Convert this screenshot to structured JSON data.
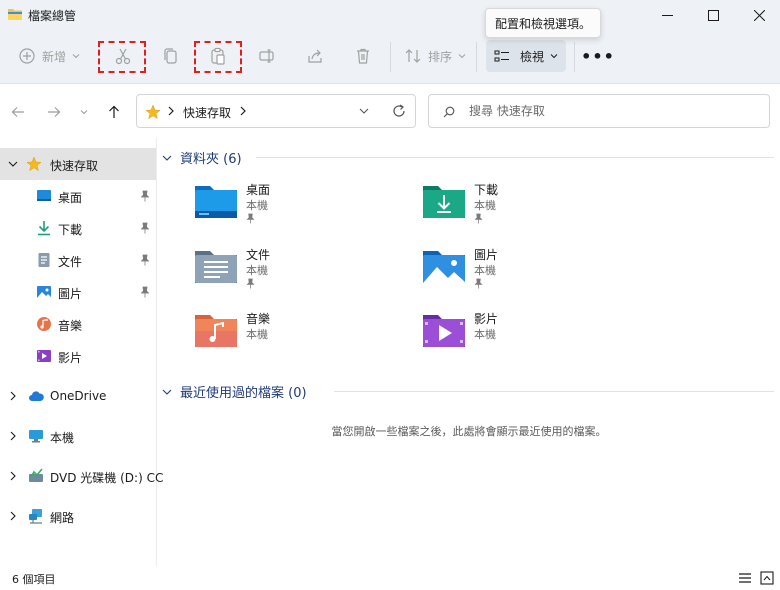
{
  "window": {
    "title": "檔案總管",
    "title_icon": "folder-icon",
    "minimize_icon": "minimize-icon",
    "maximize_icon": "maximize-icon",
    "close_icon": "close-icon"
  },
  "toolbar": {
    "new_label": "新增",
    "sort_label": "排序",
    "view_label": "檢視",
    "more_label": "•••",
    "buttons": [
      "cut-icon",
      "copy-icon",
      "paste-icon",
      "rename-icon",
      "share-icon",
      "delete-icon"
    ],
    "highlight_color": "#e0201e"
  },
  "tooltip": {
    "text": "配置和檢視選項。"
  },
  "address": {
    "crumb": "快速存取",
    "search_placeholder": "搜尋 快速存取"
  },
  "sidebar": {
    "quick_access": "快速存取",
    "items": [
      {
        "label": "桌面",
        "icon": "desktop-icon",
        "pinned": true
      },
      {
        "label": "下載",
        "icon": "download-icon",
        "pinned": true
      },
      {
        "label": "文件",
        "icon": "documents-icon",
        "pinned": true
      },
      {
        "label": "圖片",
        "icon": "pictures-icon",
        "pinned": true
      },
      {
        "label": "音樂",
        "icon": "music-icon",
        "pinned": false
      },
      {
        "label": "影片",
        "icon": "videos-icon",
        "pinned": false
      }
    ],
    "roots": [
      {
        "label": "OneDrive",
        "icon": "cloud-icon"
      },
      {
        "label": "本機",
        "icon": "computer-icon"
      },
      {
        "label": "DVD 光碟機 (D:) CC",
        "icon": "dvd-icon"
      },
      {
        "label": "網路",
        "icon": "network-icon"
      }
    ]
  },
  "content": {
    "folders_header": "資料夾 (6)",
    "folders": [
      {
        "name": "桌面",
        "location": "本機",
        "icon": "desktop-folder-icon",
        "pinned": true
      },
      {
        "name": "下載",
        "location": "本機",
        "icon": "download-folder-icon",
        "pinned": true
      },
      {
        "name": "文件",
        "location": "本機",
        "icon": "documents-folder-icon",
        "pinned": true
      },
      {
        "name": "圖片",
        "location": "本機",
        "icon": "pictures-folder-icon",
        "pinned": true
      },
      {
        "name": "音樂",
        "location": "本機",
        "icon": "music-folder-icon",
        "pinned": false
      },
      {
        "name": "影片",
        "location": "本機",
        "icon": "videos-folder-icon",
        "pinned": false
      }
    ],
    "recent_header": "最近使用過的檔案 (0)",
    "recent_empty": "當您開啟一些檔案之後，此處將會顯示最近使用的檔案。"
  },
  "status": {
    "count": "6 個項目"
  }
}
